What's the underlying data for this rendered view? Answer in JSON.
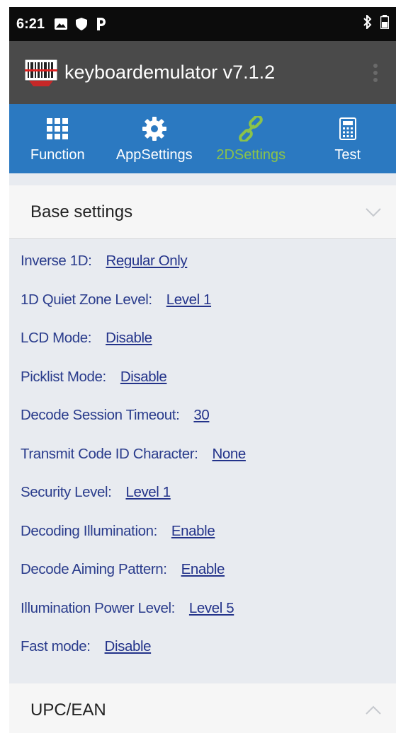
{
  "status_bar": {
    "time": "6:21",
    "left_icons": [
      "gallery-icon",
      "shield-icon",
      "parking-icon"
    ],
    "right_icons": [
      "bluetooth-icon",
      "battery-icon"
    ]
  },
  "app_bar": {
    "title": "keyboardemulator v7.1.2",
    "logo_icon": "barcode-scanner-logo",
    "overflow_icon": "overflow-menu-icon"
  },
  "tabs": [
    {
      "label": "Function",
      "icon": "grid-icon",
      "active": false
    },
    {
      "label": "AppSettings",
      "icon": "gear-icon",
      "active": false
    },
    {
      "label": "2DSettings",
      "icon": "link-icon",
      "active": true
    },
    {
      "label": "Test",
      "icon": "calculator-icon",
      "active": false
    }
  ],
  "base_settings": {
    "title": "Base settings",
    "expanded": true,
    "items": [
      {
        "label": "Inverse 1D:",
        "value": "Regular Only"
      },
      {
        "label": "1D Quiet Zone Level:",
        "value": "Level 1"
      },
      {
        "label": "LCD Mode:",
        "value": "Disable"
      },
      {
        "label": "Picklist Mode:",
        "value": "Disable"
      },
      {
        "label": "Decode Session Timeout:",
        "value": "30"
      },
      {
        "label": "Transmit Code ID Character:",
        "value": "None"
      },
      {
        "label": "Security Level:",
        "value": "Level 1"
      },
      {
        "label": "Decoding Illumination:",
        "value": "Enable"
      },
      {
        "label": "Decode Aiming Pattern:",
        "value": "Enable"
      },
      {
        "label": "Illumination Power Level:",
        "value": "Level 5"
      },
      {
        "label": "Fast mode:",
        "value": "Disable"
      }
    ]
  },
  "upc_ean": {
    "title": "UPC/EAN",
    "expanded": false
  },
  "colors": {
    "status_bar": "#0c0c0c",
    "app_bar": "#4a4a4a",
    "tab_bar": "#2b79c1",
    "tab_active": "#8bc34a",
    "setting_text": "#2a3c8c"
  }
}
